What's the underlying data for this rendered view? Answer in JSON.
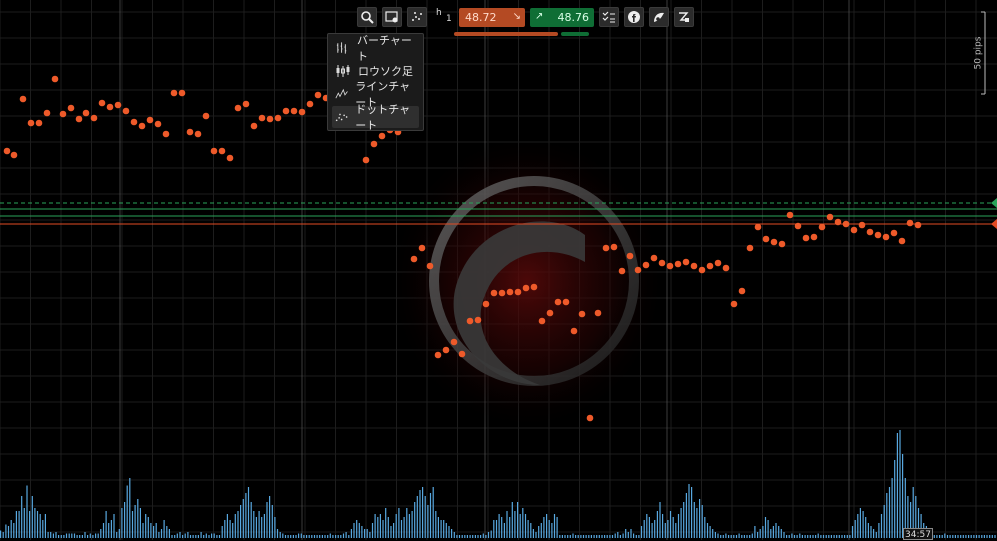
{
  "toolbar": {
    "icons": [
      "zoom-icon",
      "settings-chart-icon",
      "dot-chart-icon",
      "timeframe-icon",
      "checklist-icon",
      "facebook-icon",
      "indicator-icon",
      "drawing-icon"
    ],
    "timeframe_h": "h",
    "timeframe_n": "1",
    "sell_price": "48.72",
    "buy_price": "48.76",
    "sell_color": "#b44a23",
    "buy_color": "#0f6e35"
  },
  "chart_menu": {
    "items": [
      {
        "label": "バーチャート",
        "icon": "bar-chart-icon"
      },
      {
        "label": "ロウソク足",
        "icon": "candlestick-icon"
      },
      {
        "label": "ラインチャート",
        "icon": "line-chart-icon"
      },
      {
        "label": "ドットチャート",
        "icon": "dot-chart-icon"
      }
    ],
    "selected_index": 3
  },
  "scale": {
    "label": "50 pips"
  },
  "time_label": "34:57",
  "chart_data": {
    "type": "scatter",
    "series": [
      {
        "points": [
          [
            7,
            151
          ],
          [
            14,
            155
          ],
          [
            23,
            99
          ],
          [
            31,
            123
          ],
          [
            39,
            123
          ],
          [
            47,
            113
          ],
          [
            55,
            79
          ],
          [
            63,
            114
          ],
          [
            71,
            108
          ],
          [
            79,
            119
          ],
          [
            86,
            113
          ],
          [
            94,
            118
          ],
          [
            102,
            103
          ],
          [
            110,
            107
          ],
          [
            118,
            105
          ],
          [
            126,
            111
          ],
          [
            134,
            122
          ],
          [
            142,
            126
          ],
          [
            150,
            120
          ],
          [
            158,
            124
          ],
          [
            166,
            134
          ],
          [
            174,
            93
          ],
          [
            182,
            93
          ],
          [
            190,
            132
          ],
          [
            198,
            134
          ],
          [
            206,
            116
          ],
          [
            214,
            151
          ],
          [
            222,
            151
          ],
          [
            230,
            158
          ],
          [
            238,
            108
          ],
          [
            246,
            104
          ],
          [
            254,
            126
          ],
          [
            262,
            118
          ],
          [
            270,
            119
          ],
          [
            278,
            118
          ],
          [
            286,
            111
          ],
          [
            294,
            111
          ],
          [
            302,
            112
          ],
          [
            310,
            104
          ],
          [
            318,
            95
          ],
          [
            326,
            98
          ],
          [
            366,
            160
          ],
          [
            374,
            144
          ],
          [
            382,
            136
          ],
          [
            390,
            130
          ],
          [
            398,
            132
          ],
          [
            406,
            115
          ],
          [
            414,
            259
          ],
          [
            422,
            248
          ],
          [
            430,
            266
          ],
          [
            438,
            355
          ],
          [
            446,
            350
          ],
          [
            454,
            342
          ],
          [
            462,
            354
          ],
          [
            470,
            321
          ],
          [
            478,
            320
          ],
          [
            486,
            304
          ],
          [
            494,
            293
          ],
          [
            502,
            293
          ],
          [
            510,
            292
          ],
          [
            518,
            292
          ],
          [
            526,
            288
          ],
          [
            534,
            287
          ],
          [
            542,
            321
          ],
          [
            550,
            313
          ],
          [
            558,
            302
          ],
          [
            566,
            302
          ],
          [
            574,
            331
          ],
          [
            582,
            314
          ],
          [
            590,
            418
          ],
          [
            598,
            313
          ],
          [
            606,
            248
          ],
          [
            614,
            247
          ],
          [
            622,
            271
          ],
          [
            630,
            256
          ],
          [
            638,
            270
          ],
          [
            646,
            265
          ],
          [
            654,
            258
          ],
          [
            662,
            263
          ],
          [
            670,
            266
          ],
          [
            678,
            264
          ],
          [
            686,
            262
          ],
          [
            694,
            266
          ],
          [
            702,
            270
          ],
          [
            710,
            266
          ],
          [
            718,
            263
          ],
          [
            726,
            268
          ],
          [
            734,
            304
          ],
          [
            742,
            291
          ],
          [
            750,
            248
          ],
          [
            758,
            227
          ],
          [
            766,
            239
          ],
          [
            774,
            242
          ],
          [
            782,
            244
          ],
          [
            790,
            215
          ],
          [
            798,
            226
          ],
          [
            806,
            238
          ],
          [
            814,
            237
          ],
          [
            822,
            227
          ],
          [
            830,
            217
          ],
          [
            838,
            222
          ],
          [
            846,
            224
          ],
          [
            854,
            230
          ],
          [
            862,
            225
          ],
          [
            870,
            232
          ],
          [
            878,
            235
          ],
          [
            886,
            237
          ],
          [
            894,
            233
          ],
          [
            902,
            241
          ],
          [
            910,
            223
          ],
          [
            918,
            225
          ]
        ]
      }
    ],
    "volume_bars": [
      5,
      4,
      9,
      8,
      12,
      10,
      18,
      18,
      28,
      20,
      35,
      18,
      28,
      20,
      18,
      16,
      12,
      16,
      4,
      4,
      3,
      4,
      2,
      2,
      2,
      3,
      3,
      3,
      3,
      2,
      2,
      2,
      4,
      2,
      3,
      2,
      3,
      3,
      6,
      10,
      18,
      10,
      12,
      16,
      4,
      6,
      20,
      24,
      35,
      40,
      18,
      22,
      26,
      20,
      10,
      16,
      14,
      10,
      8,
      10,
      4,
      6,
      12,
      8,
      6,
      2,
      2,
      3,
      4,
      2,
      3,
      4,
      2,
      2,
      2,
      2,
      4,
      2,
      3,
      2,
      3,
      3,
      2,
      2,
      8,
      12,
      16,
      12,
      10,
      16,
      18,
      22,
      26,
      30,
      34,
      24,
      18,
      14,
      18,
      14,
      16,
      24,
      28,
      22,
      14,
      6,
      4,
      3,
      2,
      2,
      2,
      2,
      2,
      3,
      3,
      2,
      2,
      2,
      2,
      2,
      2,
      2,
      2,
      2,
      2,
      3,
      2,
      2,
      2,
      2,
      3,
      4,
      2,
      6,
      10,
      12,
      10,
      8,
      6,
      6,
      4,
      10,
      16,
      14,
      16,
      12,
      20,
      14,
      8,
      10,
      16,
      20,
      12,
      14,
      20,
      16,
      18,
      24,
      28,
      32,
      34,
      28,
      22,
      30,
      34,
      18,
      14,
      12,
      12,
      10,
      8,
      6,
      4,
      2,
      2,
      2,
      2,
      2,
      2,
      2,
      2,
      2,
      2,
      3,
      2,
      4,
      5,
      12,
      12,
      16,
      14,
      10,
      18,
      14,
      24,
      18,
      24,
      16,
      20,
      16,
      12,
      10,
      6,
      4,
      8,
      10,
      14,
      16,
      12,
      10,
      16,
      14,
      2,
      2,
      2,
      2,
      2,
      3,
      2,
      2,
      2,
      2,
      2,
      2,
      2,
      2,
      2,
      2,
      2,
      2,
      2,
      2,
      2,
      3,
      4,
      2,
      3,
      6,
      4,
      6,
      3,
      2,
      2,
      8,
      12,
      16,
      14,
      10,
      12,
      18,
      24,
      16,
      10,
      12,
      18,
      14,
      10,
      16,
      20,
      24,
      30,
      36,
      34,
      24,
      20,
      26,
      22,
      14,
      10,
      8,
      6,
      4,
      3,
      2,
      2,
      3,
      2,
      2,
      2,
      2,
      3,
      2,
      2,
      2,
      2,
      3,
      8,
      4,
      6,
      8,
      14,
      12,
      6,
      8,
      10,
      8,
      6,
      4,
      2,
      2,
      3,
      2,
      2,
      3,
      2,
      2,
      2,
      2,
      2,
      2,
      3,
      2,
      2,
      2,
      2,
      2,
      2,
      2,
      2,
      2,
      2,
      2,
      2,
      8,
      12,
      16,
      20,
      18,
      14,
      10,
      8,
      6,
      4,
      10,
      16,
      22,
      30,
      34,
      40,
      52,
      70,
      72,
      56,
      40,
      28,
      24,
      34,
      28,
      20,
      16,
      10,
      8,
      6,
      4,
      2,
      2,
      2,
      2,
      3,
      2,
      2,
      2,
      2,
      2,
      2,
      2,
      2,
      2,
      2,
      2,
      2,
      2,
      2,
      2,
      2,
      2,
      2,
      2
    ],
    "hlines": {
      "orange": 224,
      "green1": 216,
      "green2": 209,
      "dashed": 203
    },
    "ylabel": "",
    "xlabel": ""
  },
  "colors": {
    "dot": "#ee5a2a",
    "volume": "#58a8e0",
    "grid": "#1d1d1d",
    "grid_major": "#555555",
    "hline_orange": "#e24b24",
    "hline_green": "#2aa35a"
  }
}
